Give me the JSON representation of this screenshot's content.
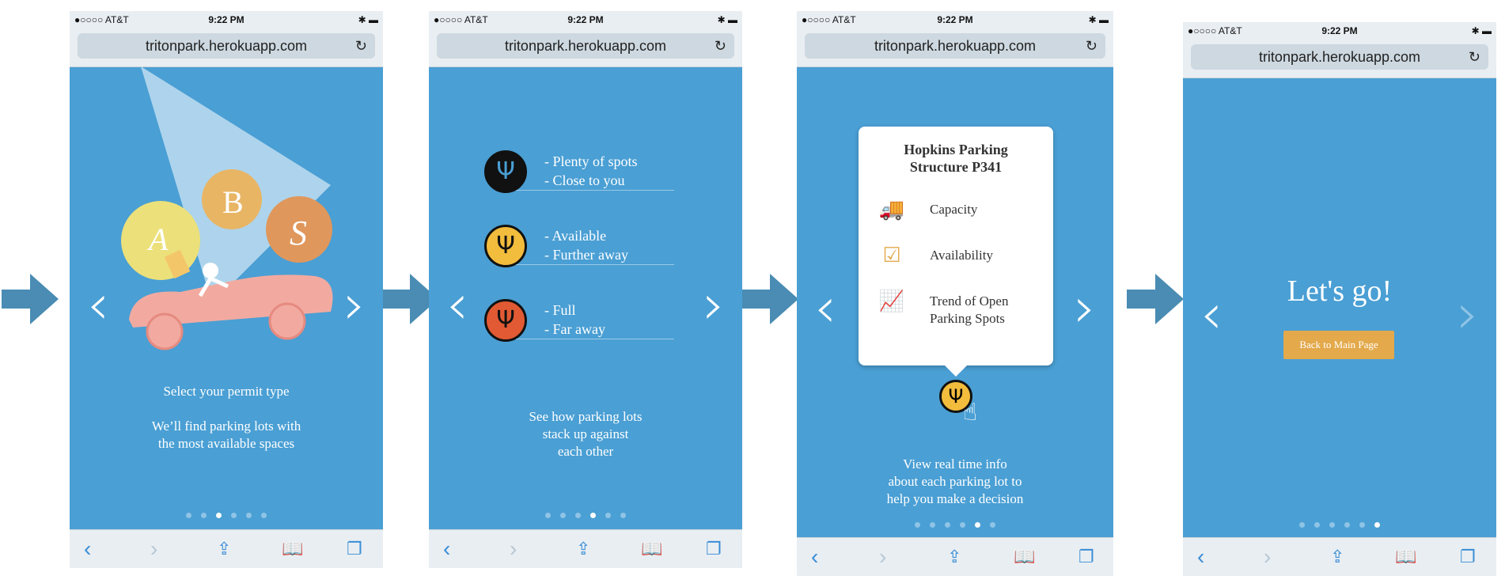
{
  "colors": {
    "background": "#4a9fd4",
    "accent": "#e3a94b",
    "chrome": "#e9eef2",
    "ios_blue": "#3a8dd6"
  },
  "status": {
    "carrier": "●○○○○ AT&T",
    "time": "9:22 PM"
  },
  "url": "tritonpark.herokuapp.com",
  "screen1": {
    "letters": [
      "A",
      "B",
      "S"
    ],
    "caption": "Select your permit type\n\nWe’ll find parking lots with\nthe most available spaces",
    "active_dot": 2
  },
  "screen2": {
    "items": [
      {
        "icon": "trident-icon-black",
        "text": "- Plenty of spots\n- Close to you",
        "color": "#111111"
      },
      {
        "icon": "trident-icon-yellow",
        "text": "- Available\n- Further away",
        "color": "#f2bc3d"
      },
      {
        "icon": "trident-icon-red",
        "text": "- Full\n- Far away",
        "color": "#e15a34"
      }
    ],
    "caption": "See how parking lots\nstack up against\neach other",
    "active_dot": 3
  },
  "screen3": {
    "card_title": "Hopkins Parking\nStructure P341",
    "rows": [
      {
        "icon": "truck-icon",
        "label": "Capacity"
      },
      {
        "icon": "calendar-check-icon",
        "label": "Availability"
      },
      {
        "icon": "trend-chart-icon",
        "label": "Trend of Open\nParking Spots"
      }
    ],
    "caption": "View real time info\nabout each parking lot to\nhelp you make a decision",
    "active_dot": 4
  },
  "screen4": {
    "title": "Let's go!",
    "button": "Back to Main Page",
    "active_dot": 5
  },
  "dots_count": 6
}
